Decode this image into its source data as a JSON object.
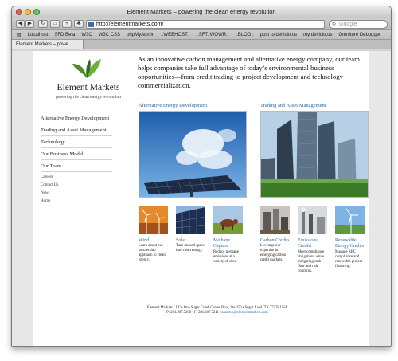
{
  "window": {
    "title": "Element Markets – powering the clean energy revolution"
  },
  "toolbar": {
    "url": "http://elementmarkets.com/",
    "search_placeholder": "Google",
    "back_icon": "back-arrow-icon",
    "forward_icon": "forward-arrow-icon"
  },
  "bookmarks": [
    "Localhost",
    "SFD Beta",
    "W3C",
    "W3C CSS",
    "phpMyAdmin",
    "::WEBHOST::",
    "::SFT::WOWR::",
    "::BLOG::",
    "post to del.icio.us",
    "my del.icio.us",
    "Omniture Debugger"
  ],
  "tab": {
    "label": "Element Markets – powe..."
  },
  "site": {
    "brand": "Element Markets",
    "tagline": "powering the clean energy revolution",
    "nav": [
      "Alternative Energy Development",
      "Trading and Asset Management",
      "Technology",
      "Our Business Model",
      "Our Team"
    ],
    "subnav": [
      "Careers",
      "Contact Us",
      "News",
      "Home"
    ],
    "intro": "As an innovative carbon management and alternative energy company, our team helps companies take full advantage of today’s environmental business opportunities—from credit trading to project development and technology commercialization.",
    "sections": {
      "alt": "Alternative Energy Development",
      "trading": "Trading and Asset Management"
    },
    "features": [
      {
        "title": "Wind",
        "desc": "Learn about our partnership approach to clean energy."
      },
      {
        "title": "Solar",
        "desc": "Turn unused space into clean energy."
      },
      {
        "title": "Methane Capture",
        "desc": "Reduce methane emissions at a variety of sites."
      },
      {
        "title": "Carbon Credits",
        "desc": "Leverage our expertise in emerging carbon credit markets."
      },
      {
        "title": "Emissions Credits",
        "desc": "Meet compliance obligations while mitigating cash flow and risk concerns."
      },
      {
        "title": "Renewable Energy Credits",
        "desc": "Manage REC compliance and renewable project financing."
      }
    ],
    "footer": {
      "address": "Element Markets LLC • One Sugar Creek Center Blvd, Ste 250 • Sugar Land, TX 77478 USA",
      "phone": "P: 281.207.7200 • F: 281.207.7211",
      "email": "contactus@elementmarkets.com"
    }
  },
  "colors": {
    "link": "#2a6aa3",
    "leaf": "#3f8a2a",
    "chrome": "#c8c8c8"
  }
}
